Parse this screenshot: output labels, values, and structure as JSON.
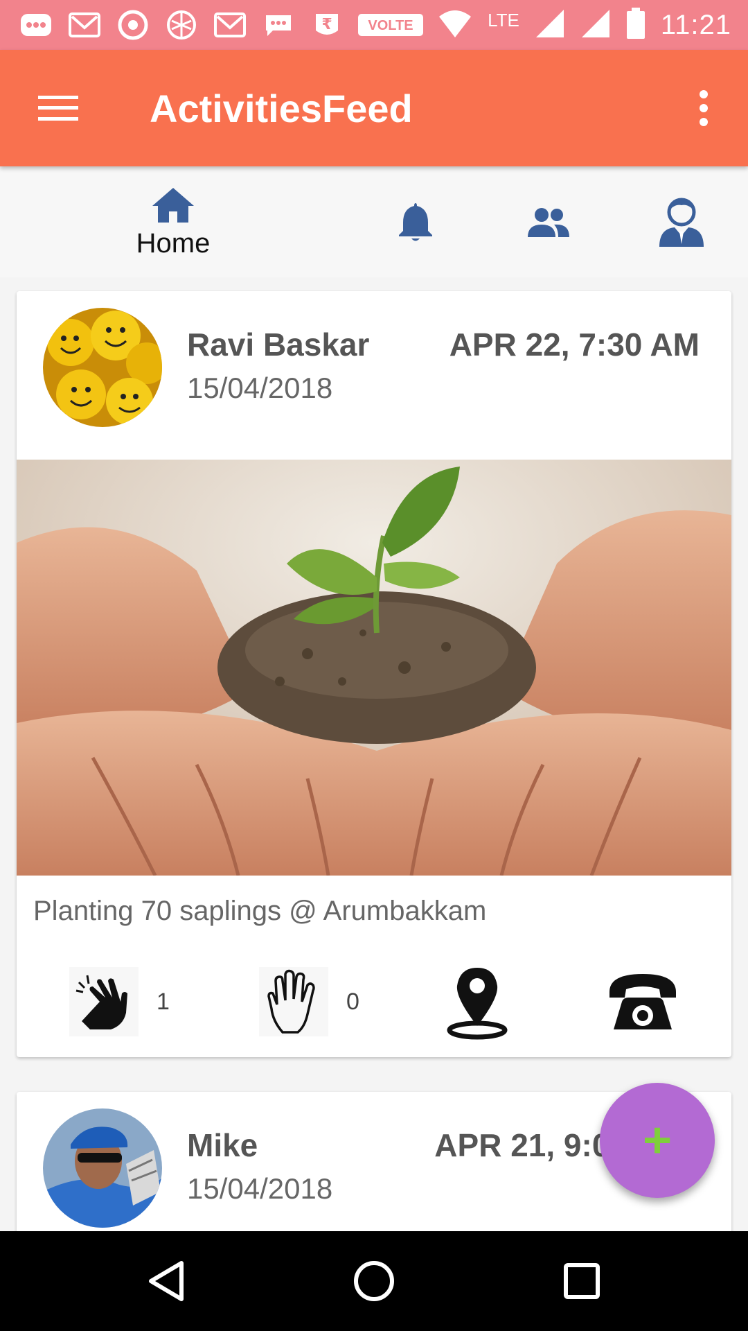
{
  "status_bar": {
    "time": "11:21",
    "volte_label": "VOLTE",
    "lte_label": "LTE",
    "icons": [
      "chat-icon",
      "gmail-icon",
      "chrome-icon",
      "app-icon",
      "gmail-icon",
      "message-icon",
      "rupee-icon",
      "volte-icon",
      "wifi-icon",
      "signal-icon",
      "signal-icon",
      "battery-icon"
    ]
  },
  "app_bar": {
    "title": "ActivitiesFeed",
    "background": "#f9714f"
  },
  "tabs": {
    "home_label": "Home",
    "accent": "#3a5f9a"
  },
  "posts": [
    {
      "author": "Ravi Baskar",
      "date": "15/04/2018",
      "time": "APR 22, 7:30 AM",
      "caption": "Planting 70 saplings @ Arumbakkam",
      "clap_count": "1",
      "hand_count": "0"
    },
    {
      "author": "Mike",
      "date": "15/04/2018",
      "time": "APR 21, 9:00"
    }
  ],
  "fab": {
    "label": "+",
    "color": "#b36ad3",
    "plus_color": "#7fcf3c"
  }
}
